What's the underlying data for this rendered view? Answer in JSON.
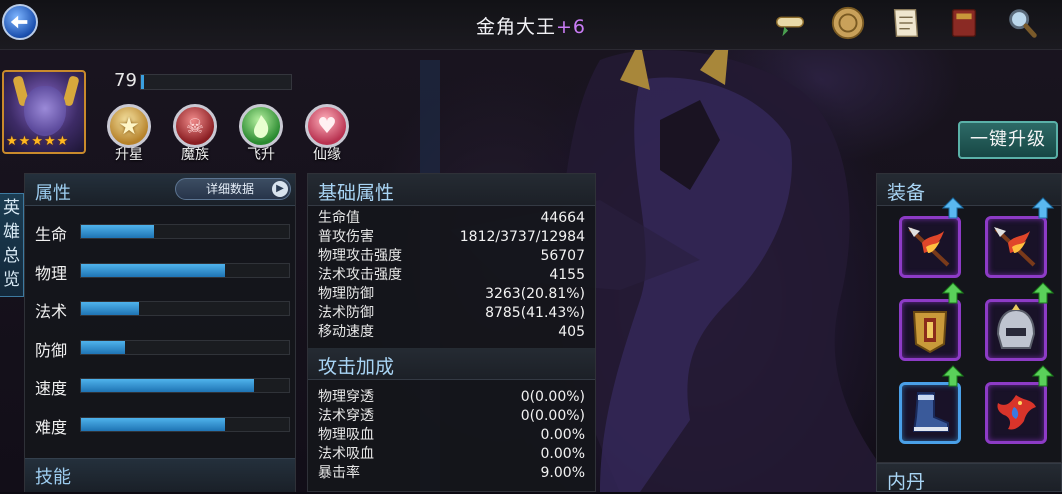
{
  "header": {
    "title": "金角大王",
    "title_plus": "+6"
  },
  "top_icons": [
    "scroll-icon",
    "coin-medallion-icon",
    "document-icon",
    "book-icon",
    "magnifier-icon"
  ],
  "hero": {
    "level": "79",
    "level_progress": 0.02,
    "stars": 5,
    "actions": [
      {
        "label": "升星",
        "icon": "star-up-icon",
        "color": "#d9a53a"
      },
      {
        "label": "魔族",
        "icon": "demon-skull-icon",
        "color": "#c64246"
      },
      {
        "label": "飞升",
        "icon": "green-flame-icon",
        "color": "#3ea840"
      },
      {
        "label": "仙缘",
        "icon": "heart-icon",
        "color": "#e0546a"
      }
    ],
    "upgrade_label": "一键升级"
  },
  "side_tab": {
    "label": "英雄总览"
  },
  "attributes": {
    "title": "属性",
    "detail_label": "详细数据",
    "rows": [
      {
        "name": "生命",
        "value": 0.35
      },
      {
        "name": "物理",
        "value": 0.69
      },
      {
        "name": "法术",
        "value": 0.28
      },
      {
        "name": "防御",
        "value": 0.21
      },
      {
        "name": "速度",
        "value": 0.83
      },
      {
        "name": "难度",
        "value": 0.69
      }
    ],
    "skills_title": "技能"
  },
  "base_stats": {
    "title": "基础属性",
    "rows": [
      {
        "label": "生命值",
        "value": "44664"
      },
      {
        "label": "普攻伤害",
        "value": "1812/3737/12984"
      },
      {
        "label": "物理攻击强度",
        "value": "56707"
      },
      {
        "label": "法术攻击强度",
        "value": "4155"
      },
      {
        "label": "物理防御",
        "value": "3263(20.81%)"
      },
      {
        "label": "法术防御",
        "value": "8785(41.43%)"
      },
      {
        "label": "移动速度",
        "value": "405"
      }
    ]
  },
  "attack_bonus": {
    "title": "攻击加成",
    "rows": [
      {
        "label": "物理穿透",
        "value": "0(0.00%)"
      },
      {
        "label": "法术穿透",
        "value": "0(0.00%)"
      },
      {
        "label": "物理吸血",
        "value": "0.00%"
      },
      {
        "label": "法术吸血",
        "value": "0.00%"
      },
      {
        "label": "暴击率",
        "value": "9.00%"
      }
    ]
  },
  "equipment": {
    "title": "装备",
    "neidan_title": "内丹",
    "slots": [
      {
        "name": "spear-slot-1",
        "icon": "flame-spear-icon",
        "upgrade": "blue"
      },
      {
        "name": "spear-slot-2",
        "icon": "flame-spear-icon",
        "upgrade": "blue"
      },
      {
        "name": "armor-slot",
        "icon": "gold-armor-icon",
        "upgrade": "green"
      },
      {
        "name": "helmet-slot",
        "icon": "silver-helmet-icon",
        "upgrade": "green"
      },
      {
        "name": "boots-slot",
        "icon": "boots-icon",
        "upgrade": "green"
      },
      {
        "name": "phoenix-slot",
        "icon": "phoenix-icon",
        "upgrade": "green"
      }
    ]
  }
}
